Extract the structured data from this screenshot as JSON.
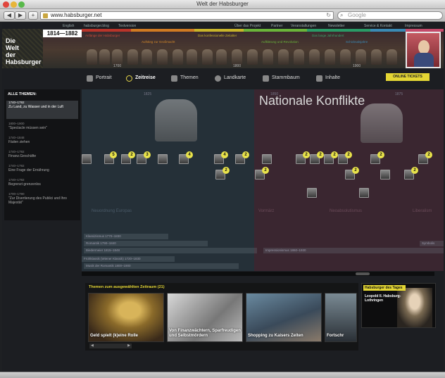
{
  "window": {
    "title": "Welt der Habsburger"
  },
  "toolbar": {
    "url": "www.habsburger.net",
    "search_placeholder": "Google",
    "back_label": "◀",
    "forward_label": "▶",
    "add_label": "+"
  },
  "topnav": {
    "left": [
      "English",
      "habsburger.blog",
      "Textversion"
    ],
    "right": [
      "Über das Projekt",
      "Partner",
      "Veranstaltungen",
      "Newsletter",
      "Service & Kontakt",
      "Impressum"
    ]
  },
  "header": {
    "logo_lines": [
      "Die",
      "Welt",
      "der",
      "Habsburger"
    ],
    "year_range": "1814—1882",
    "timeline_ticks": [
      "1700",
      "1800",
      "1900"
    ],
    "era_labels": [
      {
        "text": "Anfänge der Habsburger",
        "color": "#c84a3a"
      },
      {
        "text": "Aufstieg zur Großmacht",
        "color": "#d48a2a"
      },
      {
        "text": "Das konfessionelle Zeitalter",
        "color": "#c8b42a"
      },
      {
        "text": "Aufklärung und Revolution",
        "color": "#6ab43a"
      },
      {
        "text": "Das lange Jahrhundert",
        "color": "#3aa46a"
      },
      {
        "text": "Schicksalsjahre",
        "color": "#3a8ab4"
      },
      {
        "text": "Nationale Konflikte",
        "color": "#c44a6a"
      }
    ]
  },
  "tabs": [
    "Portrait",
    "Zeitreise",
    "Themen",
    "Landkarte",
    "Stammbaum",
    "Inhalte"
  ],
  "tickets_label": "ONLINE TICKETS",
  "sidebar": {
    "heading": "ALLE THEMEN:",
    "items": [
      {
        "year": "1740–1792",
        "text": "Zu Land, zu Wasser und in der Luft",
        "active": true
      },
      {
        "year": "1800–1900",
        "text": "\"Spectacle müssen sein\""
      },
      {
        "year": "1740–1848",
        "text": "Fäden ziehen"
      },
      {
        "year": "1740–1792",
        "text": "Finanz.Geschäfte"
      },
      {
        "year": "1740–1792",
        "text": "Eine Frage der Ernährung"
      },
      {
        "year": "1740–1792",
        "text": "Begrenzt grenzenlos"
      },
      {
        "year": "1700–1790",
        "text": "\"Zur Divertierung des Publici und Ihro Majestät\""
      }
    ]
  },
  "timeline": {
    "big_title": "Nationale Konflikte",
    "years": [
      "1825",
      "1850",
      "1875"
    ],
    "badges": [
      "5",
      "2",
      "3",
      "4",
      "4",
      "2",
      "2",
      "2",
      "2",
      "2",
      "2",
      "2",
      "2",
      "2",
      "2",
      "2"
    ],
    "eras": [
      "Neuordnung Europas",
      "Vormärz",
      "Neoabsolutismus",
      "Liberalism"
    ],
    "epochs": [
      "Klassizismus 1770–1830",
      "Romantik 1790–1840",
      "Biedermeier 1815–1848",
      "Impressionismus 1860–1930",
      "Frühklassik (Wiener Klassik) 1720–1830",
      "Musik der Romantik 1800–1900",
      "Symbolis"
    ]
  },
  "carousel": {
    "title": "Themen zum ausgewählten Zeitraum (21)",
    "items": [
      {
        "caption": "Geld spielt (k)eine Rolle"
      },
      {
        "caption": "Von Finanzwächtern, Sparfreudigen und Selbstmördern"
      },
      {
        "caption": "Shopping zu Kaisers Zeiten"
      },
      {
        "caption": "Fortschr"
      }
    ],
    "nav_prev": "◀",
    "nav_next": "▶"
  },
  "daily": {
    "heading": "Habsburger des Tages",
    "name": "Leopold II. Habsburg-Lothringen"
  }
}
